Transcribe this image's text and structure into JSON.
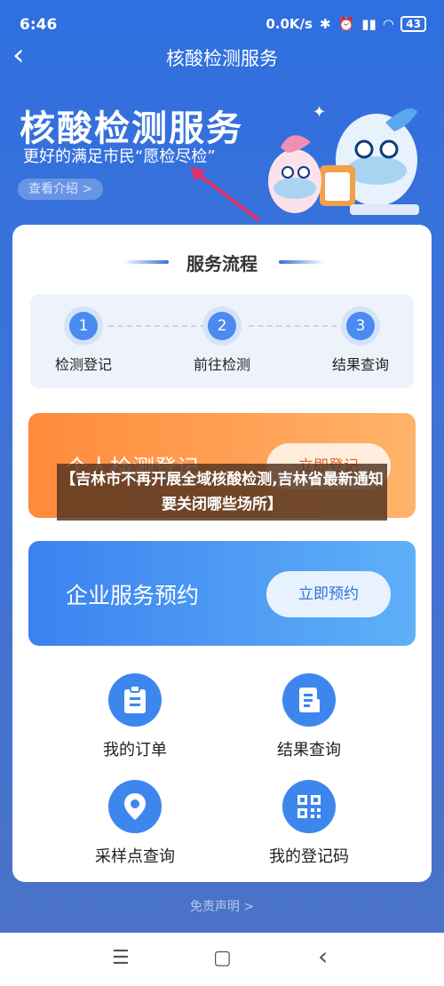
{
  "status": {
    "time": "6:46",
    "speed": "0.0K/s",
    "battery": "43"
  },
  "nav": {
    "back_icon": "‹",
    "title": "核酸检测服务"
  },
  "banner": {
    "title": "核酸检测服务",
    "subtitle": "更好的满足市民“愿检尽检”",
    "intro_label": "查看介绍 >"
  },
  "process": {
    "title": "服务流程",
    "steps": [
      {
        "num": "1",
        "label": "检测登记"
      },
      {
        "num": "2",
        "label": "前往检测"
      },
      {
        "num": "3",
        "label": "结果查询"
      }
    ]
  },
  "actions": {
    "personal": {
      "label": "个人检测登记",
      "button": "立即登记"
    },
    "enterprise": {
      "label": "企业服务预约",
      "button": "立即预约"
    }
  },
  "grid": [
    {
      "label": "我的订单",
      "icon": "clipboard-icon"
    },
    {
      "label": "结果查询",
      "icon": "document-icon"
    },
    {
      "label": "采样点查询",
      "icon": "location-pin-icon"
    },
    {
      "label": "我的登记码",
      "icon": "qr-code-icon"
    }
  ],
  "disclaimer": "免责声明 >",
  "overlay_text": "【吉林市不再开展全域核酸检测,吉林省最新通知要关闭哪些场所】",
  "system_nav": {
    "menu": "☰",
    "home": "▢",
    "back": "‹"
  }
}
